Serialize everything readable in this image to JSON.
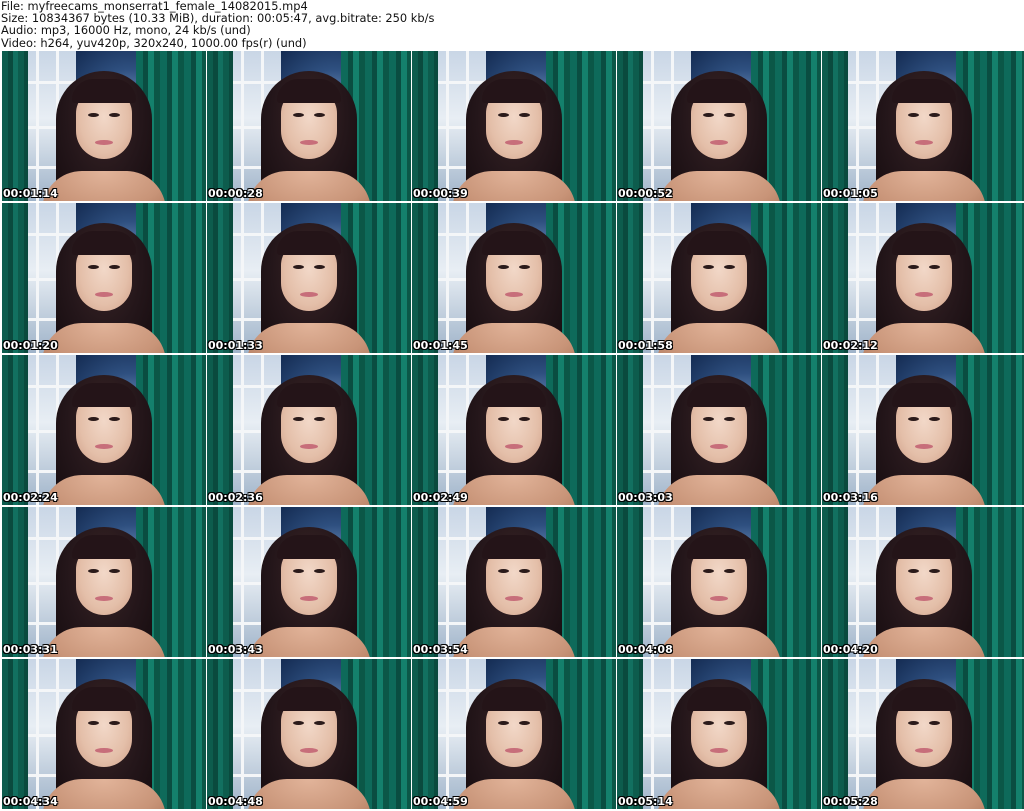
{
  "header": {
    "file": "File: myfreecams_monserrat1_female_14082015.mp4",
    "size": "Size: 10834367 bytes (10.33 MiB), duration: 00:05:47, avg.bitrate: 250 kb/s",
    "audio": "Audio: mp3, 16000 Hz, mono, 24 kb/s (und)",
    "video": "Video: h264, yuv420p, 320x240, 1000.00 fps(r) (und)"
  },
  "thumbnails": [
    {
      "time": "00:01:14"
    },
    {
      "time": "00:00:28"
    },
    {
      "time": "00:00:39"
    },
    {
      "time": "00:00:52"
    },
    {
      "time": "00:01:05"
    },
    {
      "time": "00:01:20"
    },
    {
      "time": "00:01:33"
    },
    {
      "time": "00:01:45"
    },
    {
      "time": "00:01:58"
    },
    {
      "time": "00:02:12"
    },
    {
      "time": "00:02:24"
    },
    {
      "time": "00:02:36"
    },
    {
      "time": "00:02:49"
    },
    {
      "time": "00:03:03"
    },
    {
      "time": "00:03:16"
    },
    {
      "time": "00:03:31"
    },
    {
      "time": "00:03:43"
    },
    {
      "time": "00:03:54"
    },
    {
      "time": "00:04:08"
    },
    {
      "time": "00:04:20"
    },
    {
      "time": "00:04:34"
    },
    {
      "time": "00:04:48"
    },
    {
      "time": "00:04:59"
    },
    {
      "time": "00:05:14"
    },
    {
      "time": "00:05:28"
    }
  ]
}
